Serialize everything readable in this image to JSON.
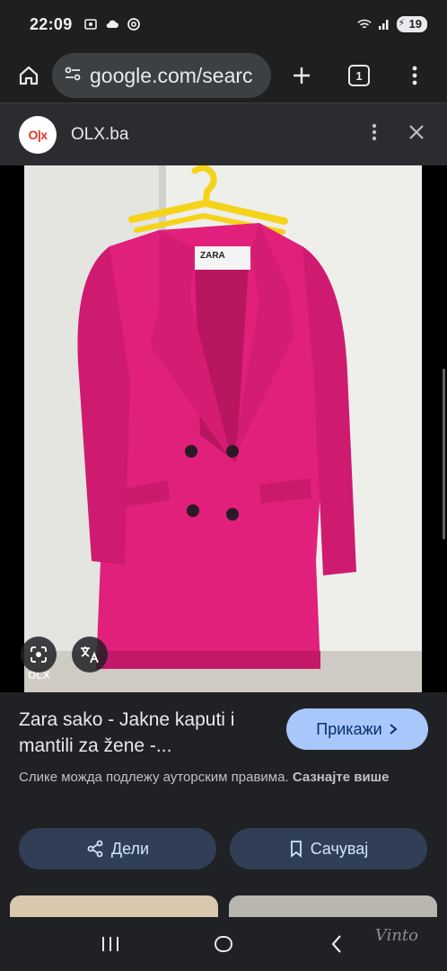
{
  "status_bar": {
    "time": "22:09",
    "battery": "19"
  },
  "toolbar": {
    "url": "google.com/searc",
    "tab_count": "1"
  },
  "source": {
    "logo_text": "O|x",
    "name": "OLX.ba"
  },
  "image": {
    "label_tag": "ZARA",
    "olx_watermark": "OLX"
  },
  "details": {
    "title": "Zara sako - Jakne kaputi i mantili za žene -...",
    "visit_label": "Прикажи",
    "copyright_text": "Слике можда подлежу ауторским правима.",
    "copyright_link": "Сазнајте више",
    "share_label": "Дели",
    "save_label": "Сачувај"
  },
  "watermark": "Vinto",
  "colors": {
    "coat": "#e0207a",
    "hanger": "#f5d31a",
    "accent_button": "#a8c7fa",
    "action_button": "#303f55"
  }
}
